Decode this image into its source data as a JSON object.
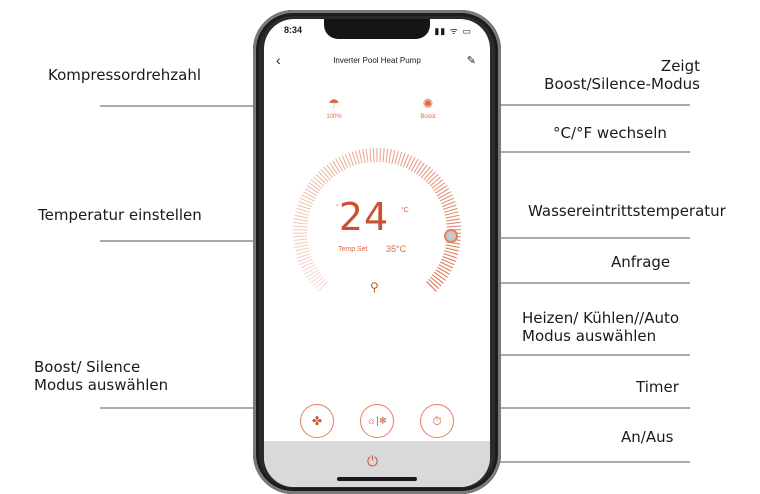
{
  "phone": {
    "status_time": "8:34",
    "status_icons": "▮▮ ᯤ ▭",
    "nav": {
      "back_icon": "‹",
      "title": "Inverter Pool Heat Pump",
      "edit_icon": "✎"
    },
    "compressor": {
      "icon": "☂",
      "value": "100%"
    },
    "boost_indicator": {
      "icon": "✺",
      "label": "Boost"
    },
    "temperature": {
      "current": "24",
      "unit_left": "°",
      "unit_right": "°C",
      "set_label": "Temp Set",
      "set_value": "35°C"
    },
    "search_icon": "⚲",
    "modes": {
      "fan_icon": "✤",
      "heat_cool_icon": "☼|❄",
      "timer_icon": "⏱"
    },
    "power_icon": "⏻"
  },
  "callouts": {
    "compressor": "Kompressordrehzahl",
    "boost_mode_line1": "Zeigt",
    "boost_mode_line2": "Boost/Silence-Modus",
    "unit_switch": "°C/°F wechseln",
    "set_temp": "Temperatur einstellen",
    "water_temp": "Wassereintrittstemperatur",
    "query": "Anfrage",
    "heat_cool_line1": "Heizen/ Kühlen//Auto",
    "heat_cool_line2": "Modus auswählen",
    "boost_silence_line1": "Boost/ Silence",
    "boost_silence_line2": "Modus auswählen",
    "timer": "Timer",
    "on_off": "An/Aus"
  },
  "colors": {
    "accent": "#d96a47",
    "accent_dark": "#c9532f"
  }
}
